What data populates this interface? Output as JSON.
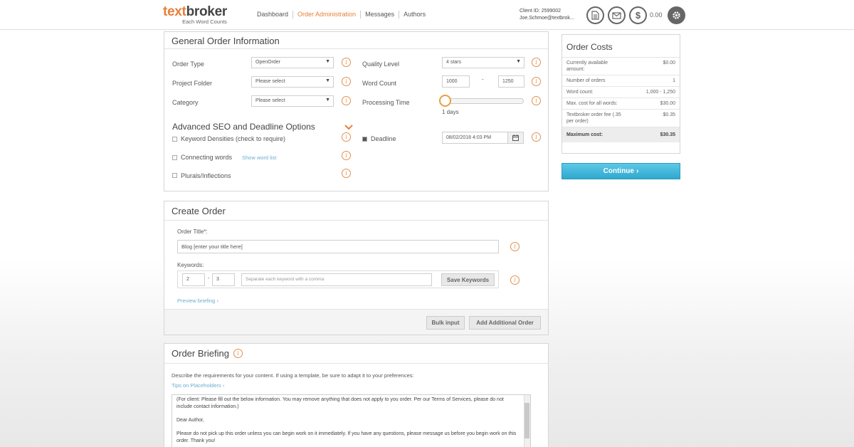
{
  "header": {
    "logo_main_a": "text",
    "logo_main_b": "broker",
    "logo_sub": "Each Word Counts",
    "nav": [
      "Dashboard",
      "Order Administration",
      "Messages",
      "Authors"
    ],
    "client_id": "Client ID: 2599002",
    "client_email": "Joe.Schmoe@textbrok...",
    "balance": "0.00",
    "icons": [
      "document-icon",
      "mail-icon",
      "dollar-icon",
      "gear-icon"
    ]
  },
  "general": {
    "title": "General Order Information",
    "order_type_label": "Order Type",
    "order_type_value": "OpenOrder",
    "project_folder_label": "Project Folder",
    "project_folder_value": "Please select",
    "category_label": "Category",
    "category_value": "Please select",
    "quality_label": "Quality Level",
    "quality_value": "4 stars",
    "word_count_label": "Word Count",
    "word_min": "1000",
    "word_sep": "-",
    "word_max": "1250",
    "processing_label": "Processing Time",
    "processing_value": "1 days",
    "advanced_title": "Advanced SEO and Deadline Options",
    "keyword_densities": "Keyword Densities (check to require)",
    "connecting_words": "Connecting words",
    "show_word_list": "Show word list",
    "plurals": "Plurals/Inflections",
    "deadline_label": "Deadline",
    "deadline_value": "08/02/2018 4:03 PM"
  },
  "costs": {
    "title": "Order Costs",
    "rows": [
      {
        "label": "Currently available amount:",
        "value": "$0.00"
      },
      {
        "label": "Number of orders",
        "value": "1"
      },
      {
        "label": "Word count:",
        "value": "1,000 - 1,250"
      },
      {
        "label": "Max. cost for all words:",
        "value": "$30.00"
      },
      {
        "label": "Textbroker order fee (.35 per order)",
        "value": "$0.35"
      }
    ],
    "total_label": "Maximum cost:",
    "total_value": "$30.35",
    "continue_label": "Continue"
  },
  "create": {
    "title": "Create Order",
    "order_title_label": "Order Title*:",
    "order_title_value": "Blog [enter your title here]",
    "keywords_label": "Keywords:",
    "kw_min": "2",
    "kw_sep": "-",
    "kw_max": "3",
    "kw_placeholder": "Separate each keyword with a comma",
    "save_keywords": "Save Keywords",
    "preview_briefing": "Preview briefing",
    "bulk_input": "Bulk input",
    "add_order": "Add Additional Order"
  },
  "briefing": {
    "title": "Order Briefing",
    "description": "Describe the requirements for your content. If using a template, be sure to adapt it to your preferences:",
    "tips_link": "Tips on Placeholders",
    "text_line1": "(For client: Please fill out the below information. You may remove anything that does not apply to you order. Per our Terms of Services, please do not include contact information.)",
    "text_line2": "Dear Author,",
    "text_line3": "Please do not pick up this order unless you can begin work on it immediately. If you have any questions, please message us before you begin work on this order. Thank you!"
  }
}
